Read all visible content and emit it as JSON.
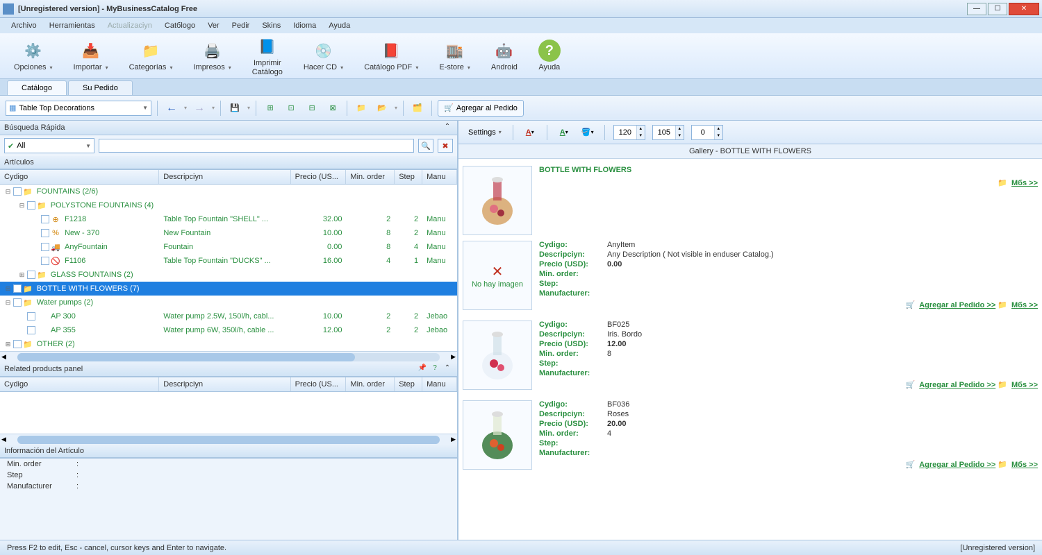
{
  "title": "[Unregistered version] - MyBusinessCatalog Free",
  "menu": [
    "Archivo",
    "Herramientas",
    "Actualizaciуn",
    "Catбlogo",
    "Ver",
    "Pedir",
    "Skins",
    "Idioma",
    "Ayuda"
  ],
  "menu_disabled_index": 2,
  "ribbon": [
    {
      "label": "Opciones",
      "icon": "⚙️",
      "bg": "#4a90d9",
      "drop": true
    },
    {
      "label": "Importar",
      "icon": "📥",
      "bg": "#e0a030",
      "drop": true
    },
    {
      "label": "Categorías",
      "icon": "📁",
      "bg": "#e0a030",
      "drop": true
    },
    {
      "label": "Impresos",
      "icon": "🖨️",
      "bg": "#e0a030",
      "drop": true
    },
    {
      "label": "Imprimir\nCatálogo",
      "icon": "📘",
      "bg": "#4a90d9",
      "drop": false
    },
    {
      "label": "Hacer CD",
      "icon": "💿",
      "bg": "#888",
      "drop": true
    },
    {
      "label": "Catálogo PDF",
      "icon": "📕",
      "bg": "#d04030",
      "drop": true,
      "badge": "PDF"
    },
    {
      "label": "E-store",
      "icon": "🏬",
      "bg": "#4a90d9",
      "drop": true
    },
    {
      "label": "Android",
      "icon": "🤖",
      "bg": "#8bc34a",
      "drop": false
    },
    {
      "label": "Ayuda",
      "icon": "?",
      "bg": "#8bc34a",
      "drop": false,
      "circle": true
    }
  ],
  "tabs": [
    {
      "label": "Catálogo",
      "active": true
    },
    {
      "label": "Su Pedido",
      "active": false
    }
  ],
  "toolbar2": {
    "category_combo": "Table Top Decorations",
    "add_order": "Agregar al Pedido"
  },
  "search": {
    "header": "Búsqueda Rápida",
    "filter": "All",
    "value": ""
  },
  "articles": {
    "header": "Artículos",
    "columns": {
      "code": "Cуdigo",
      "desc": "Descripciуn",
      "price": "Precio (US...",
      "min": "Min. order",
      "step": "Step",
      "manu": "Manu"
    },
    "col_widths": {
      "code": 230,
      "desc": 190,
      "price": 80,
      "min": 70,
      "step": 40,
      "manu": 50
    }
  },
  "tree": [
    {
      "type": "folder",
      "indent": 0,
      "expand": "-",
      "label": "FOUNTAINS   (2/6)"
    },
    {
      "type": "folder",
      "indent": 1,
      "expand": "-",
      "label": "POLYSTONE FOUNTAINS   (4)"
    },
    {
      "type": "item",
      "indent": 2,
      "icon": "⊕",
      "iconColor": "#d08000",
      "code": "F1218",
      "desc": "Table Top Fountain \"SHELL\"   ...",
      "price": "32.00",
      "min": "2",
      "step": "2",
      "manu": "Manu"
    },
    {
      "type": "item",
      "indent": 2,
      "icon": "%",
      "iconColor": "#d08000",
      "code": "New - 370",
      "desc": "New Fountain",
      "price": "10.00",
      "min": "8",
      "step": "2",
      "manu": "Manu"
    },
    {
      "type": "item",
      "indent": 2,
      "icon": "🚚",
      "iconColor": "#c03020",
      "code": "AnyFountain",
      "desc": "Fountain",
      "price": "0.00",
      "min": "8",
      "step": "4",
      "manu": "Manu"
    },
    {
      "type": "item",
      "indent": 2,
      "icon": "🚫",
      "iconColor": "#c03020",
      "code": "F1106",
      "desc": "Table Top Fountain \"DUCKS\"   ...",
      "price": "16.00",
      "min": "4",
      "step": "1",
      "manu": "Manu"
    },
    {
      "type": "folder",
      "indent": 1,
      "expand": "+",
      "label": "GLASS FOUNTAINS   (2)"
    },
    {
      "type": "folder",
      "indent": 0,
      "expand": "+",
      "label": "BOTTLE WITH FLOWERS   (7)",
      "selected": true
    },
    {
      "type": "folder",
      "indent": 0,
      "expand": "-",
      "label": "Water pumps   (2)"
    },
    {
      "type": "item",
      "indent": 1,
      "icon": "",
      "code": "AP 300",
      "desc": "Water pump 2.5W, 150l/h, cabl...",
      "price": "10.00",
      "min": "2",
      "step": "2",
      "manu": "Jebao"
    },
    {
      "type": "item",
      "indent": 1,
      "icon": "",
      "code": "AP 355",
      "desc": "Water pump 6W, 350l/h, cable ...",
      "price": "12.00",
      "min": "2",
      "step": "2",
      "manu": "Jebao"
    },
    {
      "type": "folder",
      "indent": 0,
      "expand": "+",
      "label": "OTHER   (2)"
    }
  ],
  "related": {
    "header": "Related products panel",
    "columns": {
      "code": "Cуdigo",
      "desc": "Descripciуn",
      "price": "Precio (US...",
      "min": "Min. order",
      "step": "Step",
      "manu": "Manu"
    }
  },
  "info": {
    "header": "Información del Artículo",
    "fields": [
      {
        "label": "Min. order",
        "value": ":"
      },
      {
        "label": "Step",
        "value": ":"
      },
      {
        "label": "Manufacturer",
        "value": ":"
      }
    ]
  },
  "right_tb": {
    "settings": "Settings",
    "spin1": "120",
    "spin2": "105",
    "spin3": "0"
  },
  "gallery": {
    "header": "Gallery - BOTTLE WITH FLOWERS",
    "detail_labels": {
      "code": "Cуdigo:",
      "desc": "Descripciуn:",
      "price": "Precio (USD):",
      "min": "Min. order:",
      "step": "Step:",
      "manu": "Manufacturer:"
    },
    "no_image": "No hay imagen",
    "action_add": "Agregar al Pedido >>",
    "action_more": "Mбs >>",
    "items": [
      {
        "title": "BOTTLE WITH FLOWERS",
        "has_image": true,
        "img_hint": "bottles",
        "code": "",
        "desc": "",
        "price": "",
        "min": "",
        "step": "",
        "manu": "",
        "more_only": true
      },
      {
        "title": "",
        "has_image": false,
        "code": "AnyItem",
        "desc": "Any Description ( Not visible in enduser Catalog.)",
        "price": "0.00",
        "min": "",
        "step": "",
        "manu": ""
      },
      {
        "title": "",
        "has_image": true,
        "img_hint": "iris",
        "code": "BF025",
        "desc": "Iris. Bordo",
        "price": "12.00",
        "min": "8",
        "step": "",
        "manu": ""
      },
      {
        "title": "",
        "has_image": true,
        "img_hint": "roses",
        "code": "BF036",
        "desc": "Roses",
        "price": "20.00",
        "min": "4",
        "step": "",
        "manu": ""
      }
    ]
  },
  "statusbar": {
    "left": "Press F2 to edit, Esc - cancel, cursor keys and Enter to navigate.",
    "right": "[Unregistered version]"
  }
}
